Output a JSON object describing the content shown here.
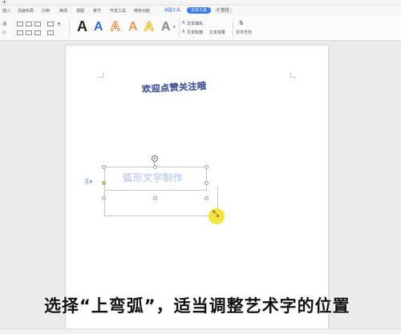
{
  "titlebar": {
    "plus": "+"
  },
  "menu": {
    "items": [
      "插入",
      "页面布局",
      "引用",
      "审阅",
      "视图",
      "章节",
      "开发工具",
      "特色功能"
    ],
    "tab_drawing": "绘图工具",
    "tab_text_tools": "文本工具",
    "search_label": "查找"
  },
  "ribbon": {
    "text_fill": "文本填充",
    "text_outline": "文本轮廓",
    "text_effect": "文本效果",
    "text_direction": "文字方向",
    "style_letter": "A",
    "style_colors": [
      "#222222",
      "#2f6fd1",
      "#e8833a",
      "#e89a5a",
      "#f2b400",
      "#888888"
    ]
  },
  "document": {
    "wordart_top": "欢迎点赞关注哦",
    "wordart_selected": "弧形文字制作"
  },
  "caption": "选择“上弯弧”，适当调整艺术字的位置"
}
